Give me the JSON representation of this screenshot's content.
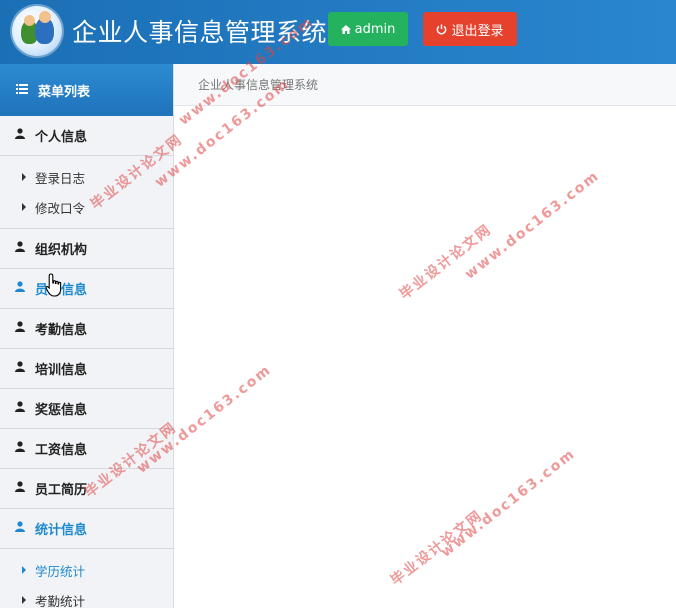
{
  "header": {
    "app_title": "企业人事信息管理系统",
    "user_button_label": "admin",
    "logout_button_label": "退出登录",
    "user_button_color": "#25b25e",
    "logout_button_color": "#e5412c"
  },
  "sidebar": {
    "title": "菜单列表",
    "items": [
      {
        "label": "个人信息",
        "active": false,
        "subitems": [
          {
            "label": "登录日志"
          },
          {
            "label": "修改口令"
          }
        ]
      },
      {
        "label": "组织机构",
        "active": false
      },
      {
        "label": "员工信息",
        "active": true
      },
      {
        "label": "考勤信息",
        "active": false
      },
      {
        "label": "培训信息",
        "active": false
      },
      {
        "label": "奖惩信息",
        "active": false
      },
      {
        "label": "工资信息",
        "active": false
      },
      {
        "label": "员工简历",
        "active": false
      },
      {
        "label": "统计信息",
        "active": true,
        "subitems": [
          {
            "label": "学历统计",
            "active": true
          },
          {
            "label": "考勤统计"
          }
        ]
      }
    ]
  },
  "main": {
    "breadcrumb": "企业人事信息管理系统"
  },
  "watermarks": {
    "line1": "毕业设计论文网",
    "line2": "www.doc163.com"
  }
}
